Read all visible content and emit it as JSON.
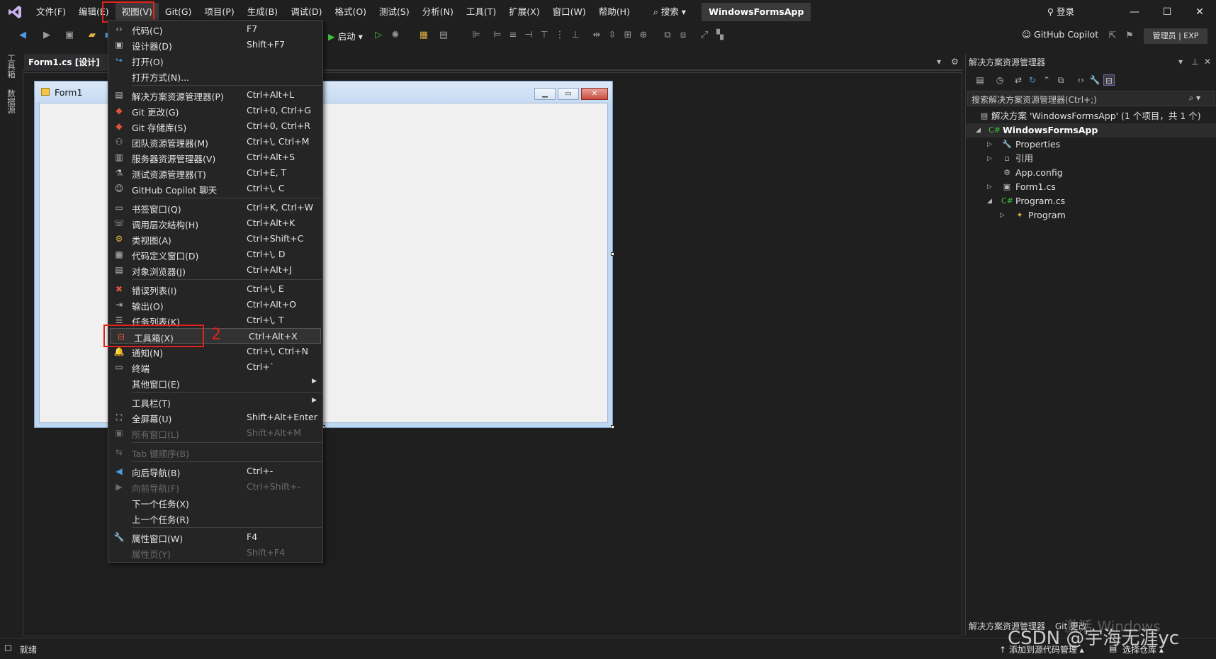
{
  "menubar": {
    "items": [
      "文件(F)",
      "编辑(E)",
      "视图(V)",
      "Git(G)",
      "项目(P)",
      "生成(B)",
      "调试(D)",
      "格式(O)",
      "测试(S)",
      "分析(N)",
      "工具(T)",
      "扩展(X)",
      "窗口(W)",
      "帮助(H)"
    ],
    "search_label": "⌕ 搜索 ▾",
    "solution_name": "WindowsFormsApp",
    "signin_label": "登录"
  },
  "toolbar": {
    "start_label": "启动",
    "copilot_label": "GitHub Copilot",
    "admin_badge": "管理员 | EXP"
  },
  "left_strip": {
    "tab1": "工具箱",
    "tab2": "数据源"
  },
  "document": {
    "tab_label": "Form1.cs [设计]",
    "pin": "⊣",
    "form_title": "Form1"
  },
  "view_menu": {
    "items": [
      {
        "icon": "‹›",
        "label": "代码(C)",
        "shortcut": "F7"
      },
      {
        "icon": "▣",
        "label": "设计器(D)",
        "shortcut": "Shift+F7"
      },
      {
        "icon": "↪",
        "label": "打开(O)",
        "shortcut": ""
      },
      {
        "icon": "",
        "label": "打开方式(N)...",
        "shortcut": ""
      },
      {
        "icon": "▤",
        "label": "解决方案资源管理器(P)",
        "shortcut": "Ctrl+Alt+L"
      },
      {
        "icon": "◆",
        "label": "Git 更改(G)",
        "shortcut": "Ctrl+0, Ctrl+G"
      },
      {
        "icon": "◆",
        "label": "Git 存储库(S)",
        "shortcut": "Ctrl+0, Ctrl+R"
      },
      {
        "icon": "⚇",
        "label": "团队资源管理器(M)",
        "shortcut": "Ctrl+\\, Ctrl+M"
      },
      {
        "icon": "▥",
        "label": "服务器资源管理器(V)",
        "shortcut": "Ctrl+Alt+S"
      },
      {
        "icon": "⚗",
        "label": "测试资源管理器(T)",
        "shortcut": "Ctrl+E, T"
      },
      {
        "icon": "☺",
        "label": "GitHub Copilot 聊天",
        "shortcut": "Ctrl+\\, C"
      },
      {
        "icon": "▭",
        "label": "书签窗口(Q)",
        "shortcut": "Ctrl+K, Ctrl+W"
      },
      {
        "icon": "☏",
        "label": "调用层次结构(H)",
        "shortcut": "Ctrl+Alt+K"
      },
      {
        "icon": "⚙",
        "label": "类视图(A)",
        "shortcut": "Ctrl+Shift+C"
      },
      {
        "icon": "▦",
        "label": "代码定义窗口(D)",
        "shortcut": "Ctrl+\\, D"
      },
      {
        "icon": "▤",
        "label": "对象浏览器(J)",
        "shortcut": "Ctrl+Alt+J"
      },
      {
        "icon": "✖",
        "label": "错误列表(I)",
        "shortcut": "Ctrl+\\, E"
      },
      {
        "icon": "⇥",
        "label": "输出(O)",
        "shortcut": "Ctrl+Alt+O"
      },
      {
        "icon": "☰",
        "label": "任务列表(K)",
        "shortcut": "Ctrl+\\, T"
      },
      {
        "icon": "⊟",
        "label": "工具箱(X)",
        "shortcut": "Ctrl+Alt+X"
      },
      {
        "icon": "🔔",
        "label": "通知(N)",
        "shortcut": "Ctrl+\\, Ctrl+N"
      },
      {
        "icon": "▭",
        "label": "终端",
        "shortcut": "Ctrl+`"
      },
      {
        "icon": "",
        "label": "其他窗口(E)",
        "shortcut": ""
      },
      {
        "icon": "",
        "label": "工具栏(T)",
        "shortcut": ""
      },
      {
        "icon": "⛶",
        "label": "全屏幕(U)",
        "shortcut": "Shift+Alt+Enter"
      },
      {
        "icon": "▣",
        "label": "所有窗口(L)",
        "shortcut": "Shift+Alt+M"
      },
      {
        "icon": "⇆",
        "label": "Tab 键顺序(B)",
        "shortcut": ""
      },
      {
        "icon": "◀",
        "label": "向后导航(B)",
        "shortcut": "Ctrl+-"
      },
      {
        "icon": "▶",
        "label": "向前导航(F)",
        "shortcut": "Ctrl+Shift+-"
      },
      {
        "icon": "",
        "label": "下一个任务(X)",
        "shortcut": ""
      },
      {
        "icon": "",
        "label": "上一个任务(R)",
        "shortcut": ""
      },
      {
        "icon": "🔧",
        "label": "属性窗口(W)",
        "shortcut": "F4"
      },
      {
        "icon": "",
        "label": "属性页(Y)",
        "shortcut": "Shift+F4"
      }
    ],
    "annotation_number": "2"
  },
  "solution_explorer": {
    "title": "解决方案资源管理器",
    "search_placeholder": "搜索解决方案资源管理器(Ctrl+;)",
    "tree": [
      {
        "label": "解决方案 'WindowsFormsApp' (1 个项目，共 1 个)",
        "icon": "▤"
      },
      {
        "label": "WindowsFormsApp",
        "icon": "C#"
      },
      {
        "label": "Properties",
        "icon": "🔧"
      },
      {
        "label": "引用",
        "icon": "▫"
      },
      {
        "label": "App.config",
        "icon": "⚙"
      },
      {
        "label": "Form1.cs",
        "icon": "▣"
      },
      {
        "label": "Program.cs",
        "icon": "C#"
      },
      {
        "label": "Program",
        "icon": "✦"
      }
    ],
    "bottom_tab": "解决方案资源管理器",
    "bottom_tab2": "Git 更改"
  },
  "status": {
    "ready": "就绪",
    "add_source": "↑ 添加到源代码管理 ▴",
    "select_repo": "选择仓库 ▴"
  },
  "watermark": {
    "windows": "激活 Windows",
    "csdn": "CSDN @宇海无涯yc"
  },
  "colors": {
    "annotation_red": "#e0231a",
    "accent": "#68217a"
  }
}
